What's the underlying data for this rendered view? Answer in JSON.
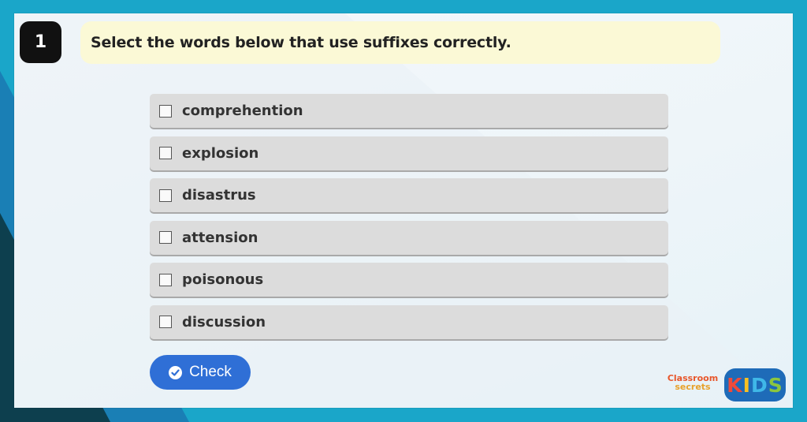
{
  "question": {
    "number": "1",
    "prompt": "Select the words below that use suffixes correctly."
  },
  "options": [
    {
      "label": "comprehention",
      "checked": false
    },
    {
      "label": "explosion",
      "checked": false
    },
    {
      "label": "disastrus",
      "checked": false
    },
    {
      "label": "attension",
      "checked": false
    },
    {
      "label": "poisonous",
      "checked": false
    },
    {
      "label": "discussion",
      "checked": false
    }
  ],
  "check_button": {
    "label": "Check",
    "icon": "check-circle-icon"
  },
  "branding": {
    "classroom_secrets_line1": "Classroom",
    "classroom_secrets_line2": "secrets",
    "kids_letters": [
      "K",
      "I",
      "D",
      "S"
    ]
  },
  "colors": {
    "frame": "#1aa6c9",
    "prompt_bg": "#fbf9d6",
    "option_bg": "#dcdcdc",
    "check_button": "#2f6fd6",
    "kids_badge": "#1e6bb8"
  }
}
